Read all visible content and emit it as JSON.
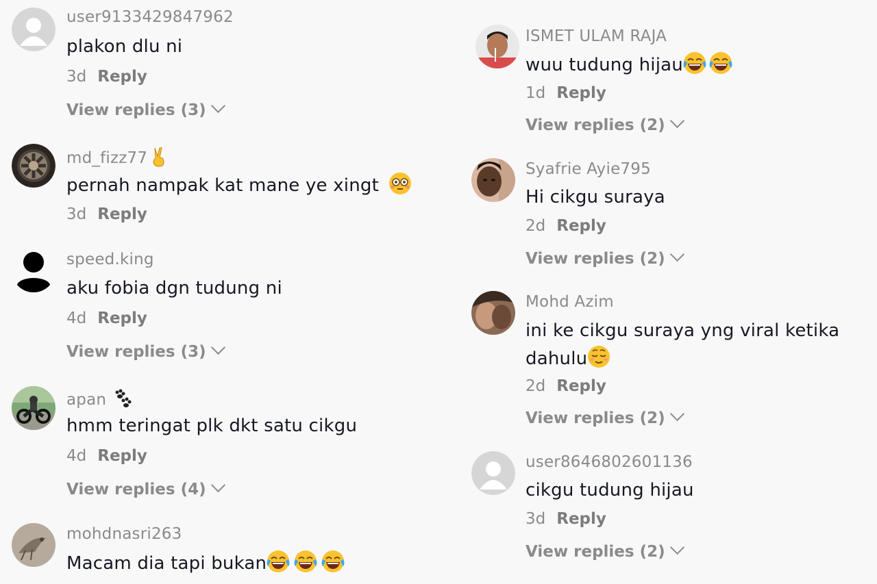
{
  "comments_left": [
    {
      "username": "user9133429847962",
      "text": "plakon dlu ni",
      "age": "3d",
      "reply_label": "Reply",
      "view_replies": "View replies (3)",
      "avatar": "default-avatar"
    },
    {
      "username": "md_fizz77",
      "username_emoji": "victory-hand-emoji",
      "text": "pernah nampak kat mane ye xingt",
      "text_emoji": "flushed-face-emoji",
      "age": "3d",
      "reply_label": "Reply",
      "avatar": "car-wheel-avatar"
    },
    {
      "username": "speed.king",
      "text": "aku fobia dgn tudung ni",
      "age": "4d",
      "reply_label": "Reply",
      "view_replies": "View replies (3)",
      "avatar": "silhouette-avatar"
    },
    {
      "username": "apan",
      "username_emoji": "paw-prints-emoji",
      "text": "hmm teringat plk dkt satu cikgu",
      "age": "4d",
      "reply_label": "Reply",
      "view_replies": "View replies (4)",
      "avatar": "motorbike-avatar"
    },
    {
      "username": "mohdnasri263",
      "text": "Macam dia tapi bukan",
      "text_emoji": "tears-of-joy-emoji",
      "avatar": "bird-avatar"
    }
  ],
  "comments_right": [
    {
      "username": "ISMET ULAM RAJA",
      "text": "wuu tudung hijau",
      "text_emoji": "tears-of-joy-emoji",
      "age": "1d",
      "reply_label": "Reply",
      "view_replies": "View replies (2)",
      "avatar": "person-avatar"
    },
    {
      "username": "Syafrie Ayie795",
      "text": "Hi cikgu suraya",
      "age": "2d",
      "reply_label": "Reply",
      "view_replies": "View replies (2)",
      "avatar": "face-avatar"
    },
    {
      "username": "Mohd Azim",
      "text_line1": "ini ke cikgu suraya yng viral ketika",
      "text_line2": "dahulu",
      "text_emoji": "relieved-face-emoji",
      "age": "2d",
      "reply_label": "Reply",
      "view_replies": "View replies (2)",
      "avatar": "couple-avatar"
    },
    {
      "username": "user8646802601136",
      "text": "cikgu tudung hijau",
      "age": "3d",
      "reply_label": "Reply",
      "view_replies": "View replies (2)",
      "avatar": "default-avatar"
    }
  ]
}
